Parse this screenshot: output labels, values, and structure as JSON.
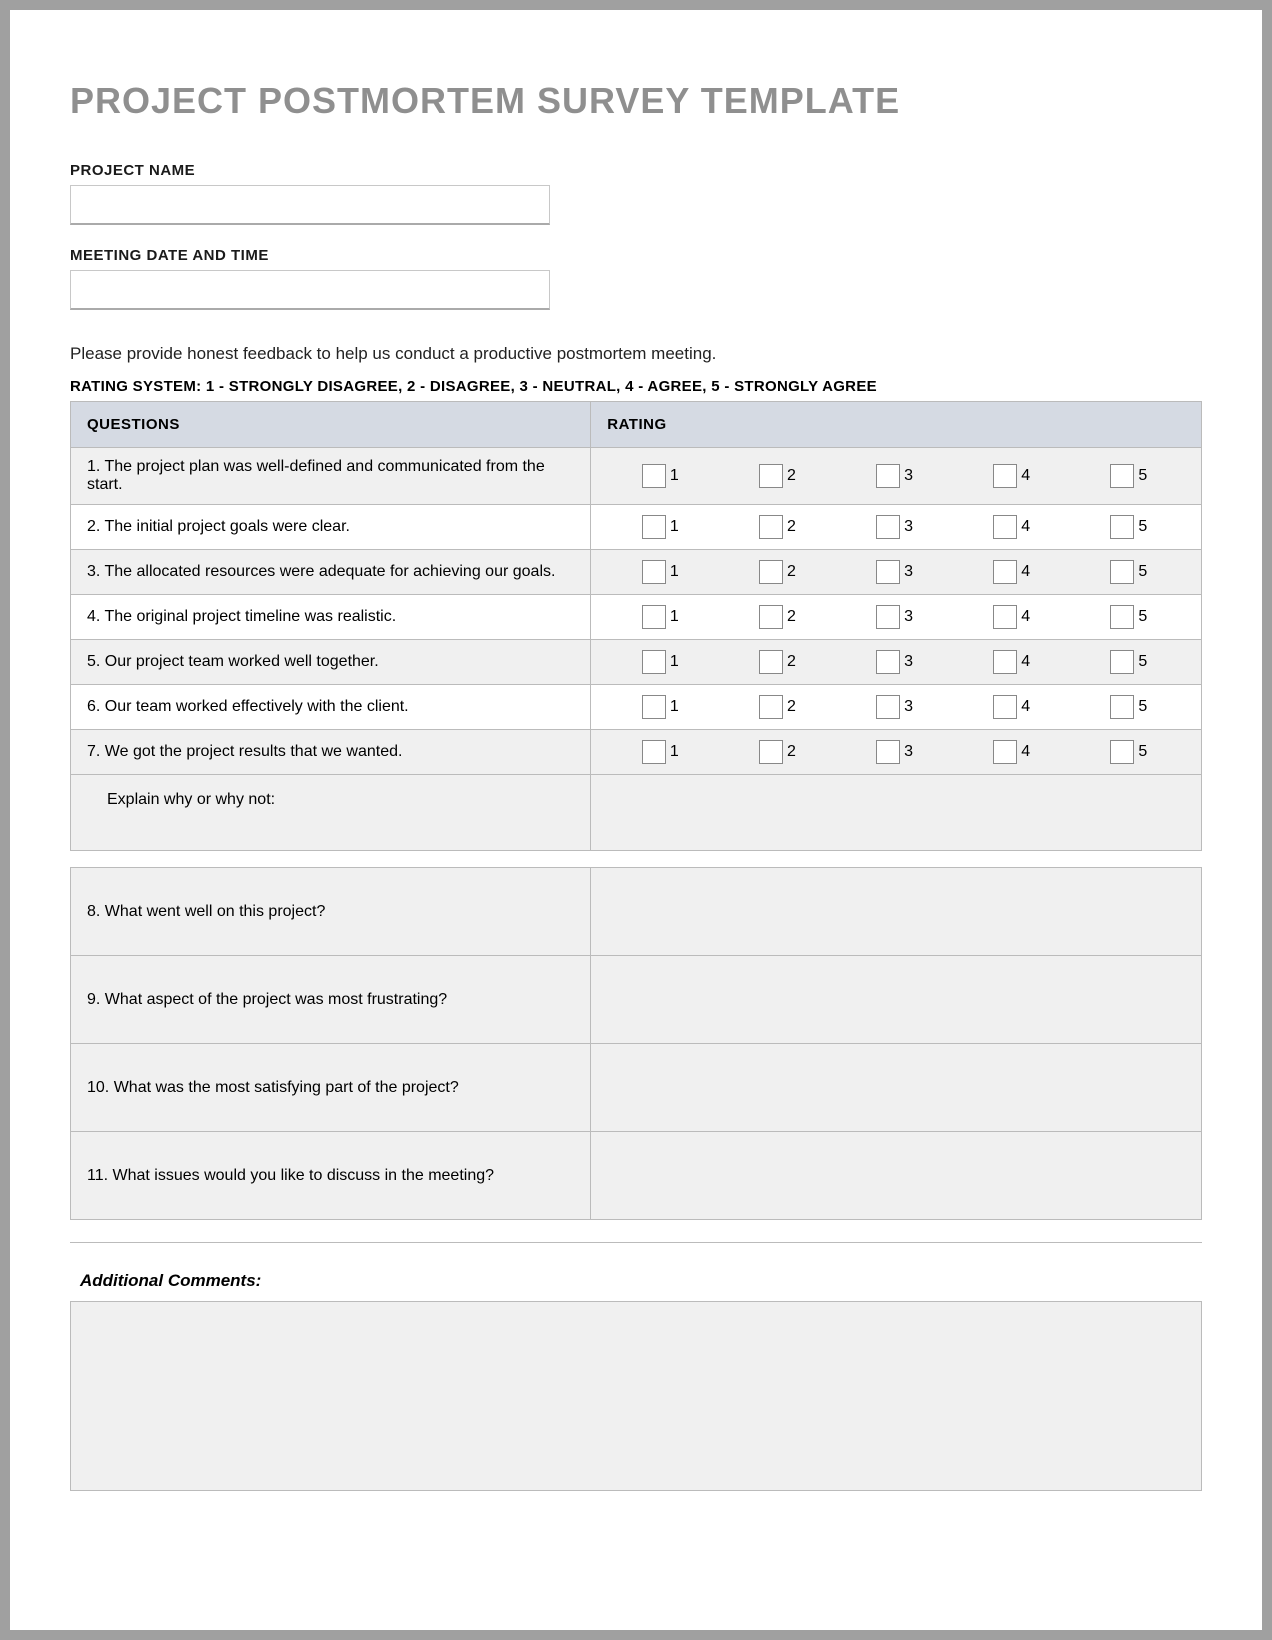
{
  "title": "PROJECT POSTMORTEM SURVEY TEMPLATE",
  "fields": {
    "project_name_label": "PROJECT NAME",
    "project_name_value": "",
    "meeting_label": "MEETING DATE AND TIME",
    "meeting_value": ""
  },
  "instruction": "Please provide honest feedback to help us conduct a productive postmortem meeting.",
  "rating_key": "RATING SYSTEM: 1 - STRONGLY DISAGREE, 2 - DISAGREE, 3 - NEUTRAL, 4 - AGREE, 5 - STRONGLY AGREE",
  "headers": {
    "questions": "QUESTIONS",
    "rating": "RATING"
  },
  "rating_scale": [
    "1",
    "2",
    "3",
    "4",
    "5"
  ],
  "questions": [
    "1. The project plan was well-defined and communicated from the start.",
    "2. The initial project goals were clear.",
    "3. The allocated resources were adequate for achieving our goals.",
    "4. The original project timeline was realistic.",
    "5. Our project team worked well together.",
    "6. Our team worked effectively with the client.",
    "7. We got the project results that we wanted."
  ],
  "explain_label": "Explain why or why not:",
  "open_questions": [
    "8. What went well on this project?",
    "9. What aspect of the project was most frustrating?",
    "10. What was the most satisfying part of the project?",
    "11. What issues would you like to discuss in the meeting?"
  ],
  "comments_label": "Additional Comments:"
}
